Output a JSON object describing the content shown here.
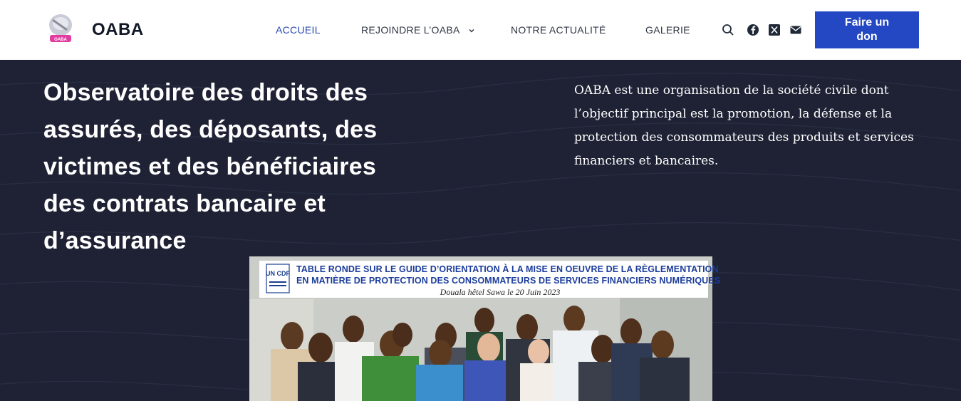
{
  "header": {
    "brand": "OABA",
    "logo_text": "OABA",
    "nav": [
      {
        "label": "ACCUEIL",
        "active": true
      },
      {
        "label": "REJOINDRE L’OABA",
        "has_dropdown": true
      },
      {
        "label": "NOTRE ACTUALITÉ"
      },
      {
        "label": "GALERIE"
      }
    ],
    "icons": [
      "search-icon",
      "facebook-icon",
      "x-twitter-icon",
      "mail-icon"
    ],
    "cta_label_1": "Faire un",
    "cta_label_2": "don"
  },
  "hero": {
    "title_lines": [
      "Observatoire des droits des",
      "assurés, des déposants, des",
      "victimes et des bénéficiaires",
      "des contrats bancaire et",
      "d’assurance"
    ],
    "description": "OABA est une organisation de la société civile dont l’objectif principal est la promotion, la défense et la protection des consommateurs des produits et services financiers et bancaires."
  },
  "photo": {
    "logo_text": "UN CDF",
    "banner_line_1": "TABLE RONDE SUR LE GUIDE D’ORIENTATION À LA MISE EN OEUVRE DE LA RÈGLEMENTATION",
    "banner_line_2": "EN MATIÈRE DE PROTECTION DES CONSOMMATEURS DE SERVICES FINANCIERS NUMÉRIQUES",
    "banner_line_3": "Douala hêtel Sawa le 20 Juin 2023"
  },
  "colors": {
    "accent": "#2447c4",
    "nav_active": "#2747b5",
    "hero_bg": "#1e2234",
    "text_dark": "#111827"
  }
}
